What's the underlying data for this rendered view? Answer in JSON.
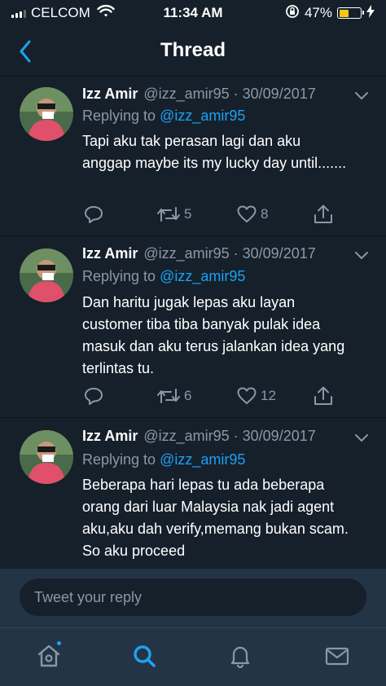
{
  "status_bar": {
    "carrier": "CELCOM",
    "time": "11:34 AM",
    "battery": "47%",
    "battery_level": 0.47,
    "battery_color": "#f5c518"
  },
  "header": {
    "title": "Thread",
    "back_icon": "chevron-left-icon"
  },
  "tweets": [
    {
      "name": "Izz Amir",
      "handle": "@izz_amir95",
      "date": "· 30/09/2017",
      "replying_prefix": "Replying to",
      "replying_to": "@izz_amir95",
      "text": "Tapi aku tak perasan lagi dan aku anggap maybe its my lucky day until.......",
      "retweets": "5",
      "likes": "8"
    },
    {
      "name": "Izz Amir",
      "handle": "@izz_amir95",
      "date": "· 30/09/2017",
      "replying_prefix": "Replying to",
      "replying_to": "@izz_amir95",
      "text": "Dan haritu jugak lepas aku layan customer tiba tiba banyak pulak idea masuk dan aku terus jalankan idea yang terlintas tu.",
      "retweets": "6",
      "likes": "12"
    },
    {
      "name": "Izz Amir",
      "handle": "@izz_amir95",
      "date": "· 30/09/2017",
      "replying_prefix": "Replying to",
      "replying_to": "@izz_amir95",
      "text": "Beberapa hari lepas tu ada beberapa orang dari luar Malaysia nak jadi agent aku,aku dah verify,memang bukan scam. So aku proceed",
      "retweets": "",
      "likes": ""
    }
  ],
  "reply_box": {
    "placeholder": "Tweet your reply"
  },
  "tab_bar": {
    "items": [
      "home-icon",
      "search-icon",
      "bell-icon",
      "mail-icon"
    ],
    "active": "search-icon"
  },
  "colors": {
    "background": "#15202b",
    "accent": "#1da1f2",
    "muted": "#8899a6",
    "bar": "#243447"
  }
}
